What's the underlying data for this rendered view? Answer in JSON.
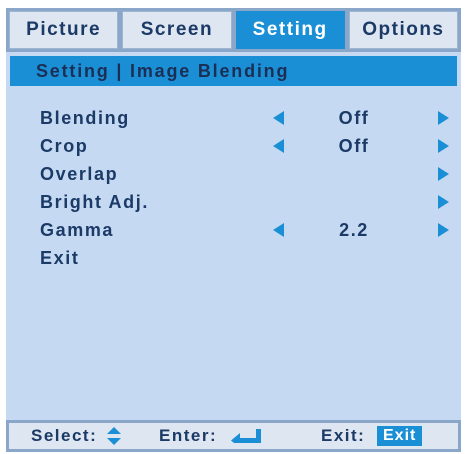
{
  "tabs": [
    {
      "label": "Picture",
      "active": false
    },
    {
      "label": "Screen",
      "active": false
    },
    {
      "label": "Setting",
      "active": true
    },
    {
      "label": "Options",
      "active": false
    }
  ],
  "breadcrumb": "Setting | Image Blending",
  "menu": {
    "items": [
      {
        "label": "Blending",
        "value": "Off",
        "left_arrow": true,
        "right_arrow": true
      },
      {
        "label": "Crop",
        "value": "Off",
        "left_arrow": true,
        "right_arrow": true
      },
      {
        "label": "Overlap",
        "value": "",
        "left_arrow": false,
        "right_arrow": true
      },
      {
        "label": "Bright Adj.",
        "value": "",
        "left_arrow": false,
        "right_arrow": true
      },
      {
        "label": "Gamma",
        "value": "2.2",
        "left_arrow": true,
        "right_arrow": true
      },
      {
        "label": "Exit",
        "value": "",
        "left_arrow": false,
        "right_arrow": false
      }
    ]
  },
  "footer": {
    "select_label": "Select:",
    "enter_label": "Enter:",
    "exit_label": "Exit:",
    "exit_badge": "Exit"
  },
  "colors": {
    "background": "#c5d9f2",
    "accent": "#1a8fd6",
    "text": "#1b3a66",
    "frame": "#8aa7c9"
  },
  "icons": {
    "select": "up-down-arrow-icon",
    "enter": "enter-return-icon",
    "value_left": "arrow-left-icon",
    "value_right": "arrow-right-icon"
  }
}
